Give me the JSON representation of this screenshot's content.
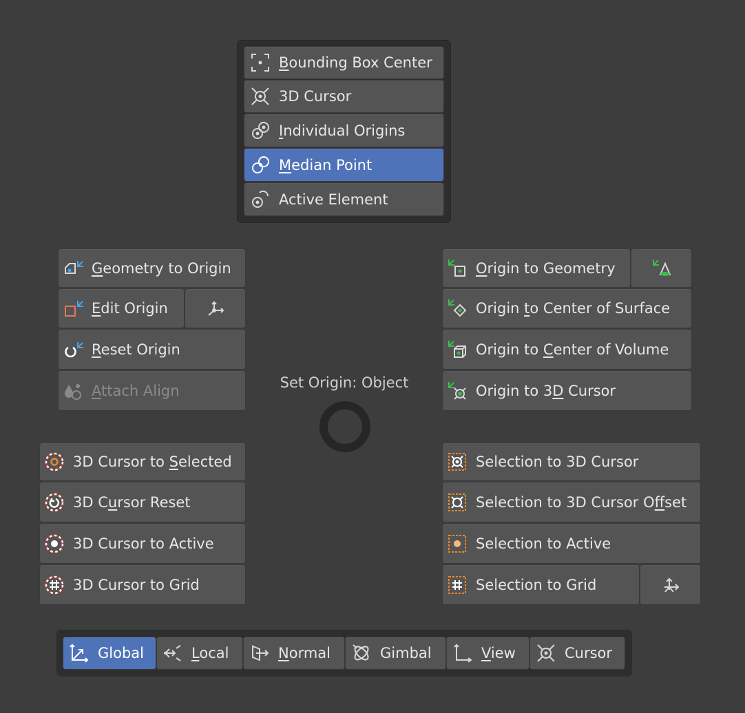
{
  "pivot_menu": {
    "items": [
      {
        "pre": "",
        "u": "B",
        "post": "ounding Box Center",
        "icon": "bounding-box-center-icon"
      },
      {
        "pre": "3D Cursor",
        "u": "",
        "post": "",
        "icon": "3d-cursor-icon"
      },
      {
        "pre": "",
        "u": "I",
        "post": "ndividual Origins",
        "icon": "individual-origins-icon"
      },
      {
        "pre": "",
        "u": "M",
        "post": "edian Point",
        "icon": "median-point-icon",
        "active": true
      },
      {
        "pre": "Active Element",
        "u": "",
        "post": "",
        "icon": "active-element-icon"
      }
    ]
  },
  "center": {
    "label": "Set Origin: Object"
  },
  "origin_left": {
    "geometry_to_origin": {
      "pre": "",
      "u": "G",
      "post": "eometry to Origin"
    },
    "edit_origin": {
      "pre": "",
      "u": "E",
      "post": "dit Origin"
    },
    "reset_origin": {
      "pre": "",
      "u": "R",
      "post": "eset Origin"
    },
    "attach_align": {
      "pre": "",
      "u": "A",
      "post": "ttach Align"
    }
  },
  "origin_right": {
    "origin_to_geometry": {
      "pre": "",
      "u": "O",
      "post": "rigin to Geometry"
    },
    "origin_to_surface": {
      "pre": "Origin ",
      "u": "t",
      "post": "o Center of Surface"
    },
    "origin_to_volume": {
      "pre": "Origin to ",
      "u": "C",
      "post": "enter of Volume"
    },
    "origin_to_cursor": {
      "pre": "Origin to 3",
      "u": "D",
      "post": " Cursor"
    }
  },
  "cursor_menu": {
    "to_selected": {
      "pre": "3D Cursor to ",
      "u": "S",
      "post": "elected"
    },
    "reset": {
      "pre": "3D C",
      "u": "u",
      "post": "rsor Reset"
    },
    "to_active": {
      "pre": "3D Cursor to Active",
      "u": "",
      "post": ""
    },
    "to_grid": {
      "pre": "3D Cursor to Grid",
      "u": "",
      "post": ""
    }
  },
  "selection_menu": {
    "to_cursor": {
      "pre": "Selection to 3D Cursor",
      "u": "",
      "post": ""
    },
    "to_cursor_offset": {
      "pre": "Selection to 3D Cursor O",
      "u": "f",
      "post": "fset"
    },
    "to_active": {
      "pre": "Selection to Active",
      "u": "",
      "post": ""
    },
    "to_grid": {
      "pre": "Selection to Grid",
      "u": "",
      "post": ""
    }
  },
  "orientation_bar": {
    "global": {
      "pre": "Global",
      "u": "",
      "post": ""
    },
    "local": {
      "pre": "",
      "u": "L",
      "post": "ocal"
    },
    "normal": {
      "pre": "",
      "u": "N",
      "post": "ormal"
    },
    "gimbal": {
      "pre": "Gimbal",
      "u": "",
      "post": ""
    },
    "view": {
      "pre": "",
      "u": "V",
      "post": "iew"
    },
    "cursor": {
      "pre": "Cursor",
      "u": "",
      "post": ""
    }
  },
  "colors": {
    "background": "#3d3d3d",
    "button": "#545454",
    "active": "#4f73b8",
    "orange": "#e88a2a",
    "blue": "#4aa3e8",
    "green": "#3dbb4f"
  }
}
